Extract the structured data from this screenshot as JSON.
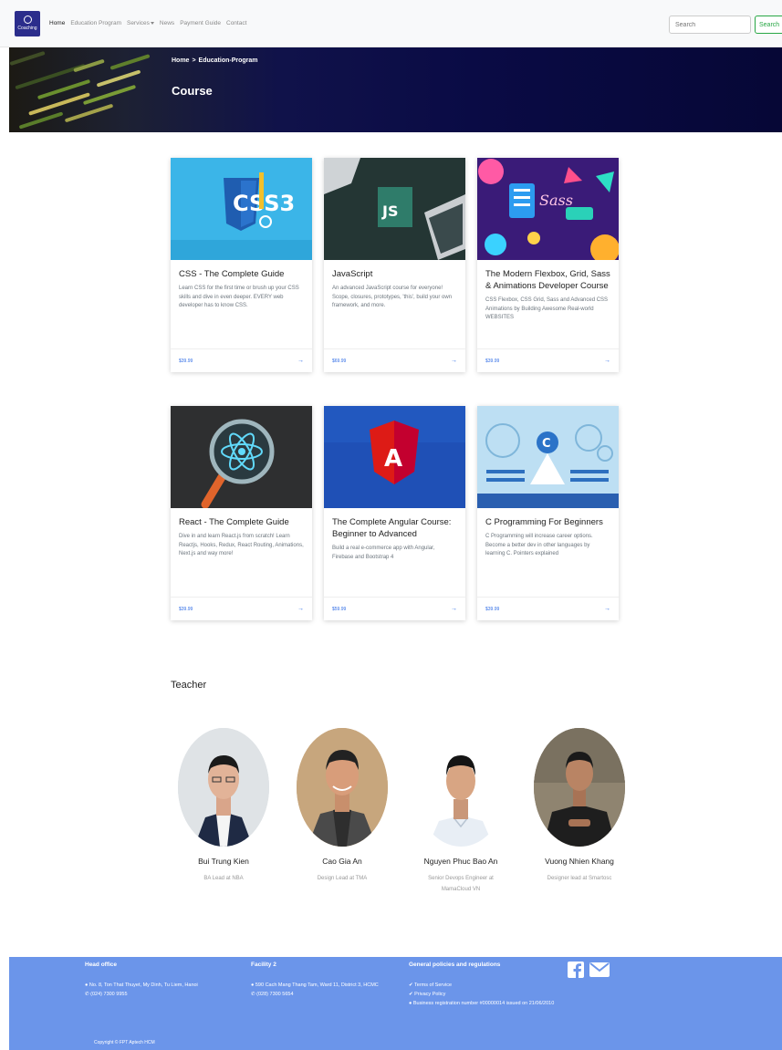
{
  "nav": {
    "logo_text": "Coaching",
    "links": [
      {
        "label": "Home",
        "active": true
      },
      {
        "label": "Education Program",
        "active": false
      },
      {
        "label": "Services",
        "active": false,
        "dropdown": true
      },
      {
        "label": "News",
        "active": false
      },
      {
        "label": "Payment Guide",
        "active": false
      },
      {
        "label": "Contact",
        "active": false
      }
    ],
    "search_placeholder": "Search",
    "search_button": "Search"
  },
  "banner": {
    "breadcrumb_home": "Home",
    "breadcrumb_sep": ">",
    "breadcrumb_current": "Education-Program",
    "title": "Course"
  },
  "courses": [
    {
      "title": "CSS - The Complete Guide",
      "desc": "Learn CSS for the first time or brush up your CSS skills and dive in even deeper. EVERY web developer has to know CSS.",
      "price": "$39.99",
      "img_label": "CSS3"
    },
    {
      "title": "JavaScript",
      "desc": "An advanced JavaScript course for everyone! Scope, closures, prototypes, 'this', build your own framework, and more.",
      "price": "$69.99",
      "img_label": "JS"
    },
    {
      "title": "The Modern Flexbox, Grid, Sass & Animations Developer Course",
      "desc": "CSS Flexbox, CSS Grid, Sass and Advanced CSS Animations by Building Awesome Real-world WEBSITES",
      "price": "$39.99",
      "img_label": "Sass"
    },
    {
      "title": "React - The Complete Guide",
      "desc": "Dive in and learn React.js from scratch! Learn Reactjs, Hooks, Redux, React Routing, Animations, Next.js and way more!",
      "price": "$39.99",
      "img_label": "React"
    },
    {
      "title": "The Complete Angular Course: Beginner to Advanced",
      "desc": "Build a real e-commerce app with Angular, Firebase and Bootstrap 4",
      "price": "$59.99",
      "img_label": "A"
    },
    {
      "title": "C Programming For Beginners",
      "desc": "C Programming will increase career options. Become a better dev in other languages by learning C. Pointers explained",
      "price": "$39.99",
      "img_label": "C"
    }
  ],
  "teachers_title": "Teacher",
  "teachers": [
    {
      "name": "Bui Trung Kien",
      "role": "BA Lead at NBA"
    },
    {
      "name": "Cao Gia An",
      "role": "Design Lead at TMA"
    },
    {
      "name": "Nguyen Phuc Bao An",
      "role": "Senior Devops Engineer at MamaCloud VN"
    },
    {
      "name": "Vuong Nhien Khang",
      "role": "Designer lead at Smartosc"
    }
  ],
  "footer": {
    "head_office_title": "Head office",
    "head_office_address": "No. 8, Ton That Thuyet, My Dinh, Tu Liem, Hanoi",
    "head_office_phone": "(024) 7300 9955",
    "facility_title": "Facility 2",
    "facility_address": "590 Cach Mang Thang Tam, Ward 11, District 3, HCMC",
    "facility_phone": "(028) 7300 5654",
    "policies_title": "General policies and regulations",
    "policy_terms": "Terms of Service",
    "policy_privacy": "Privacy Policy",
    "business_reg": "Business registration number #00000014 issued on 21/06/2010",
    "copyright": "Copyright © FPT Aptech HCM"
  },
  "colors": {
    "brand": "#2b2d8c",
    "accent": "#2e6be6",
    "footer": "#6b95ea",
    "search": "#28a745"
  }
}
